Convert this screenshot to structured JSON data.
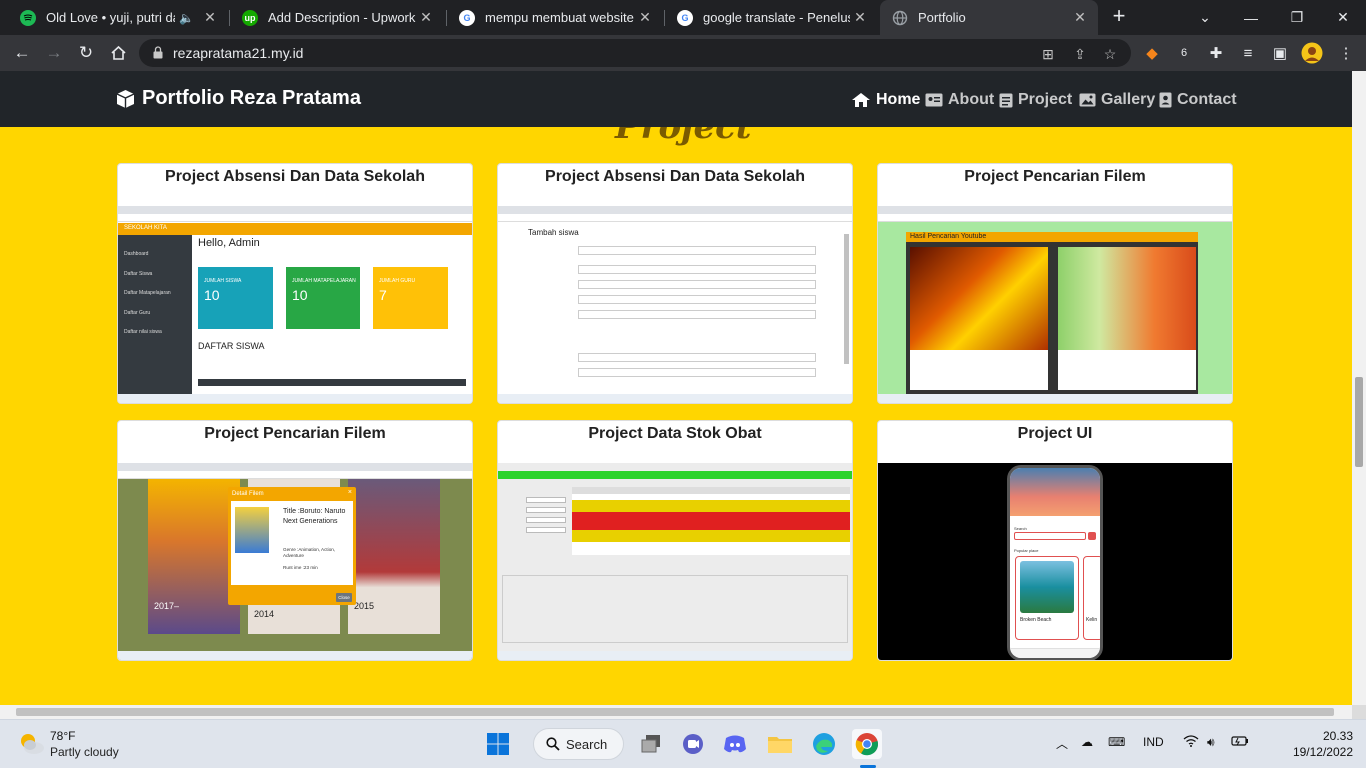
{
  "browser": {
    "tabs": [
      {
        "title": "Old Love • yuji, putri dahlia",
        "favicon": "spotify-icon",
        "color": "#1db954",
        "audio": true
      },
      {
        "title": "Add Description - Upwork",
        "favicon": "upwork-icon",
        "color": "#14a800"
      },
      {
        "title": "mempu membuat website be",
        "favicon": "google-icon",
        "color": "#4285f4"
      },
      {
        "title": "google translate - Penelusura",
        "favicon": "google-icon",
        "color": "#4285f4"
      },
      {
        "title": "Portfolio",
        "favicon": "globe-icon",
        "color": "#8ab4f8",
        "active": true
      }
    ],
    "new_tab": "+",
    "url": "rezapratama21.my.id",
    "extension_badge": "6"
  },
  "site": {
    "brand": "Portfolio Reza Pratama",
    "nav": {
      "home": "Home",
      "about": "About",
      "project": "Project",
      "gallery": "Gallery",
      "contact": "Contact"
    },
    "section_heading": "Project",
    "projects": [
      {
        "title": "Project Absensi Dan Data Sekolah"
      },
      {
        "title": "Project Absensi Dan Data Sekolah"
      },
      {
        "title": "Project Pencarian Filem"
      },
      {
        "title": "Project Pencarian Filem"
      },
      {
        "title": "Project Data Stok Obat"
      },
      {
        "title": "Project UI"
      }
    ],
    "shot1": {
      "app_name": "SEKOLAH KITA",
      "greeting": "Hello, Admin",
      "cards": [
        {
          "label": "JUMLAH SISWA",
          "value": "10",
          "color": "#17a2b8"
        },
        {
          "label": "JUMLAH MATAPELAJARAN",
          "value": "10",
          "color": "#28a745"
        },
        {
          "label": "JUMLAH GURU",
          "value": "7",
          "color": "#ffc107"
        }
      ],
      "menu": [
        "Dashboard",
        "Daftar Siswa",
        "Daftar Matapelajaran",
        "Daftar Guru",
        "Daftar nilai siswa"
      ],
      "section": "DAFTAR SISWA"
    },
    "shot2": {
      "heading": "Tambah siswa"
    },
    "shot3": {
      "banner": "Hasil Pencarian Youtube"
    },
    "shot4": {
      "modal_title": "Detail Filem",
      "film_title": "Title :Boruto: Naruto Next Generations",
      "genre": "Genre :Animation, Action, Adventure",
      "runtime": "Runt ime :23 min",
      "years": [
        "2017–",
        "2014",
        "2015"
      ],
      "close": "Close"
    },
    "shot6": {
      "search_label": "Search",
      "popular_label": "Popular place",
      "place": "Broken Beach",
      "place2": "Kelin"
    }
  },
  "taskbar": {
    "weather_temp": "78°F",
    "weather_desc": "Partly cloudy",
    "search": "Search",
    "language": "IND",
    "time": "20.33",
    "date": "19/12/2022"
  }
}
